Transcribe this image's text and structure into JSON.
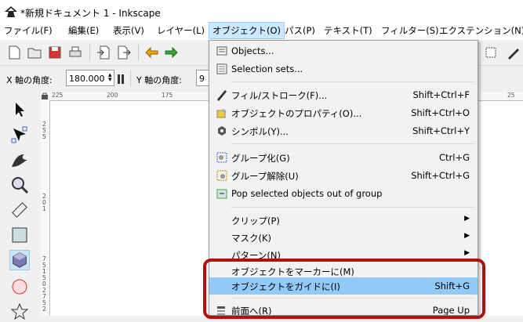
{
  "window": {
    "title": "*新規ドキュメント 1 - Inkscape",
    "app_icon": "inkscape-icon"
  },
  "menubar": {
    "items": [
      {
        "label": "ファイル(F)"
      },
      {
        "label": "編集(E)"
      },
      {
        "label": "表示(V)"
      },
      {
        "label": "レイヤー(L)"
      },
      {
        "label": "オブジェクト(O)"
      },
      {
        "label": "パス(P)"
      },
      {
        "label": "テキスト(T)"
      },
      {
        "label": "フィルター(S)"
      },
      {
        "label": "エクステンション(N)"
      }
    ]
  },
  "toolbar2": {
    "x_angle_label": "X 軸の角度:",
    "x_angle_value": "180.000",
    "y_angle_label": "Y 軸の角度:",
    "y_angle_value": "9"
  },
  "ruler": {
    "h_ticks": [
      "225",
      "200",
      "175",
      "25"
    ],
    "v_ticks": [
      "2",
      "5",
      "5",
      "2",
      "0",
      "1",
      "7",
      "5",
      "1",
      "5",
      "0",
      "2",
      "7",
      "5",
      "2"
    ]
  },
  "dropdown": {
    "items": [
      {
        "label": "Objects...",
        "shortcut": "",
        "icon": "objects-icon"
      },
      {
        "label": "Selection sets...",
        "shortcut": "",
        "icon": "selection-sets-icon"
      },
      {
        "label": "フィル/ストローク(F)...",
        "shortcut": "Shift+Ctrl+F",
        "icon": "fill-stroke-icon"
      },
      {
        "label": "オブジェクトのプロパティ(O)...",
        "shortcut": "Shift+Ctrl+O",
        "icon": "object-properties-icon"
      },
      {
        "label": "シンボル(Y)...",
        "shortcut": "Shift+Ctrl+Y",
        "icon": "symbols-icon"
      },
      {
        "label": "グループ化(G)",
        "shortcut": "Ctrl+G",
        "icon": "group-icon"
      },
      {
        "label": "グループ解除(U)",
        "shortcut": "Shift+Ctrl+G",
        "icon": "ungroup-icon"
      },
      {
        "label": "Pop selected objects out of group",
        "shortcut": "",
        "icon": "pop-out-group-icon"
      },
      {
        "label": "クリップ(P)",
        "shortcut": "",
        "icon": ""
      },
      {
        "label": "マスク(K)",
        "shortcut": "",
        "icon": ""
      },
      {
        "label": "パターン(N)",
        "shortcut": "",
        "icon": ""
      },
      {
        "label": "オブジェクトをマーカーに(M)",
        "shortcut": "",
        "icon": ""
      },
      {
        "label": "オブジェクトをガイドに(I)",
        "shortcut": "Shift+G",
        "icon": ""
      },
      {
        "label": "前面へ(R)",
        "shortcut": "Page Up",
        "icon": "raise-icon"
      }
    ]
  },
  "colors": {
    "highlight": "#91c9f7",
    "annotation": "#b01010",
    "menu_active": "#cce8ff"
  }
}
